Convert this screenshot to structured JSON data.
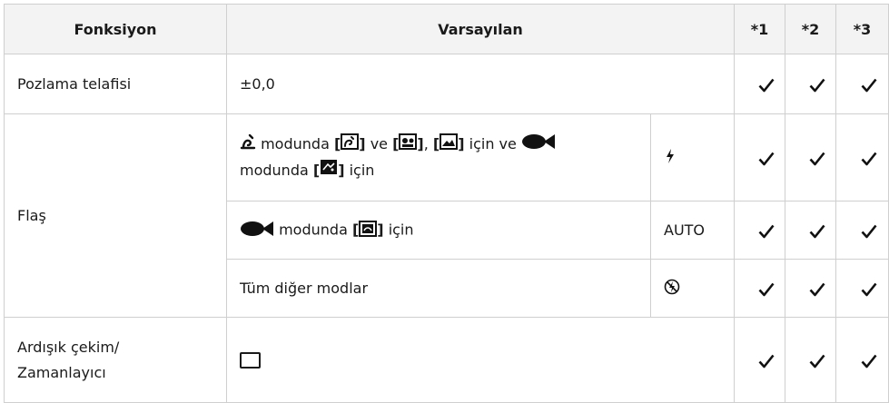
{
  "headers": {
    "function": "Fonksiyon",
    "default": "Varsayılan",
    "c1": "*1",
    "c2": "*2",
    "c3": "*3"
  },
  "rows": {
    "exposure": {
      "label": "Pozlama telafisi",
      "value": "±0,0",
      "checks": [
        true,
        true,
        true
      ]
    },
    "flash": {
      "label": "Flaş",
      "sub": [
        {
          "t_modunda": "modunda",
          "t_ve": "ve",
          "t_comma": ",",
          "t_icin_ve": "için ve",
          "t_modunda2": "modunda",
          "t_icin": "için",
          "value_icon": "flash-fill-in-icon",
          "checks": [
            true,
            true,
            true
          ]
        },
        {
          "t_modunda": "modunda",
          "t_icin": "için",
          "value": "AUTO",
          "checks": [
            true,
            true,
            true
          ]
        },
        {
          "text": "Tüm diğer modlar",
          "value_icon": "flash-off-icon",
          "checks": [
            true,
            true,
            true
          ]
        }
      ]
    },
    "drive": {
      "label_line1": "Ardışık çekim/",
      "label_line2": "Zamanlayıcı",
      "value_icon": "single-frame-icon",
      "checks": [
        true,
        true,
        true
      ]
    }
  },
  "icons": {
    "scene_mode": "scene-mode-icon",
    "underwater": "underwater-fish-icon",
    "check": "check-icon"
  }
}
